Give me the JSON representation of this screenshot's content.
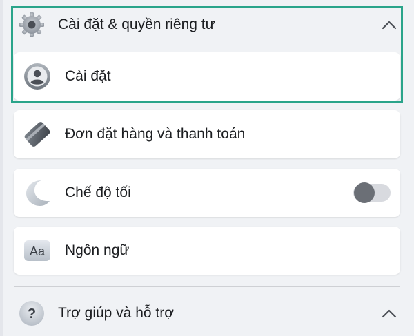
{
  "settings_section": {
    "title": "Cài đặt & quyền riêng tư",
    "icon": "gear-icon",
    "expanded": true,
    "items": [
      {
        "label": "Cài đặt",
        "icon": "profile-icon"
      },
      {
        "label": "Đơn đặt hàng và thanh toán",
        "icon": "card-icon"
      },
      {
        "label": "Chế độ tối",
        "icon": "moon-icon",
        "toggle_on": false
      },
      {
        "label": "Ngôn ngữ",
        "icon": "language-icon",
        "icon_text": "Aa"
      }
    ]
  },
  "help_section": {
    "title": "Trợ giúp và hỗ trợ",
    "icon": "help-icon",
    "icon_text": "?",
    "expanded": true
  },
  "colors": {
    "background": "#f0f2f5",
    "card": "#ffffff",
    "highlight": "#2aa48a",
    "toggle_off": "#6b6f76"
  }
}
